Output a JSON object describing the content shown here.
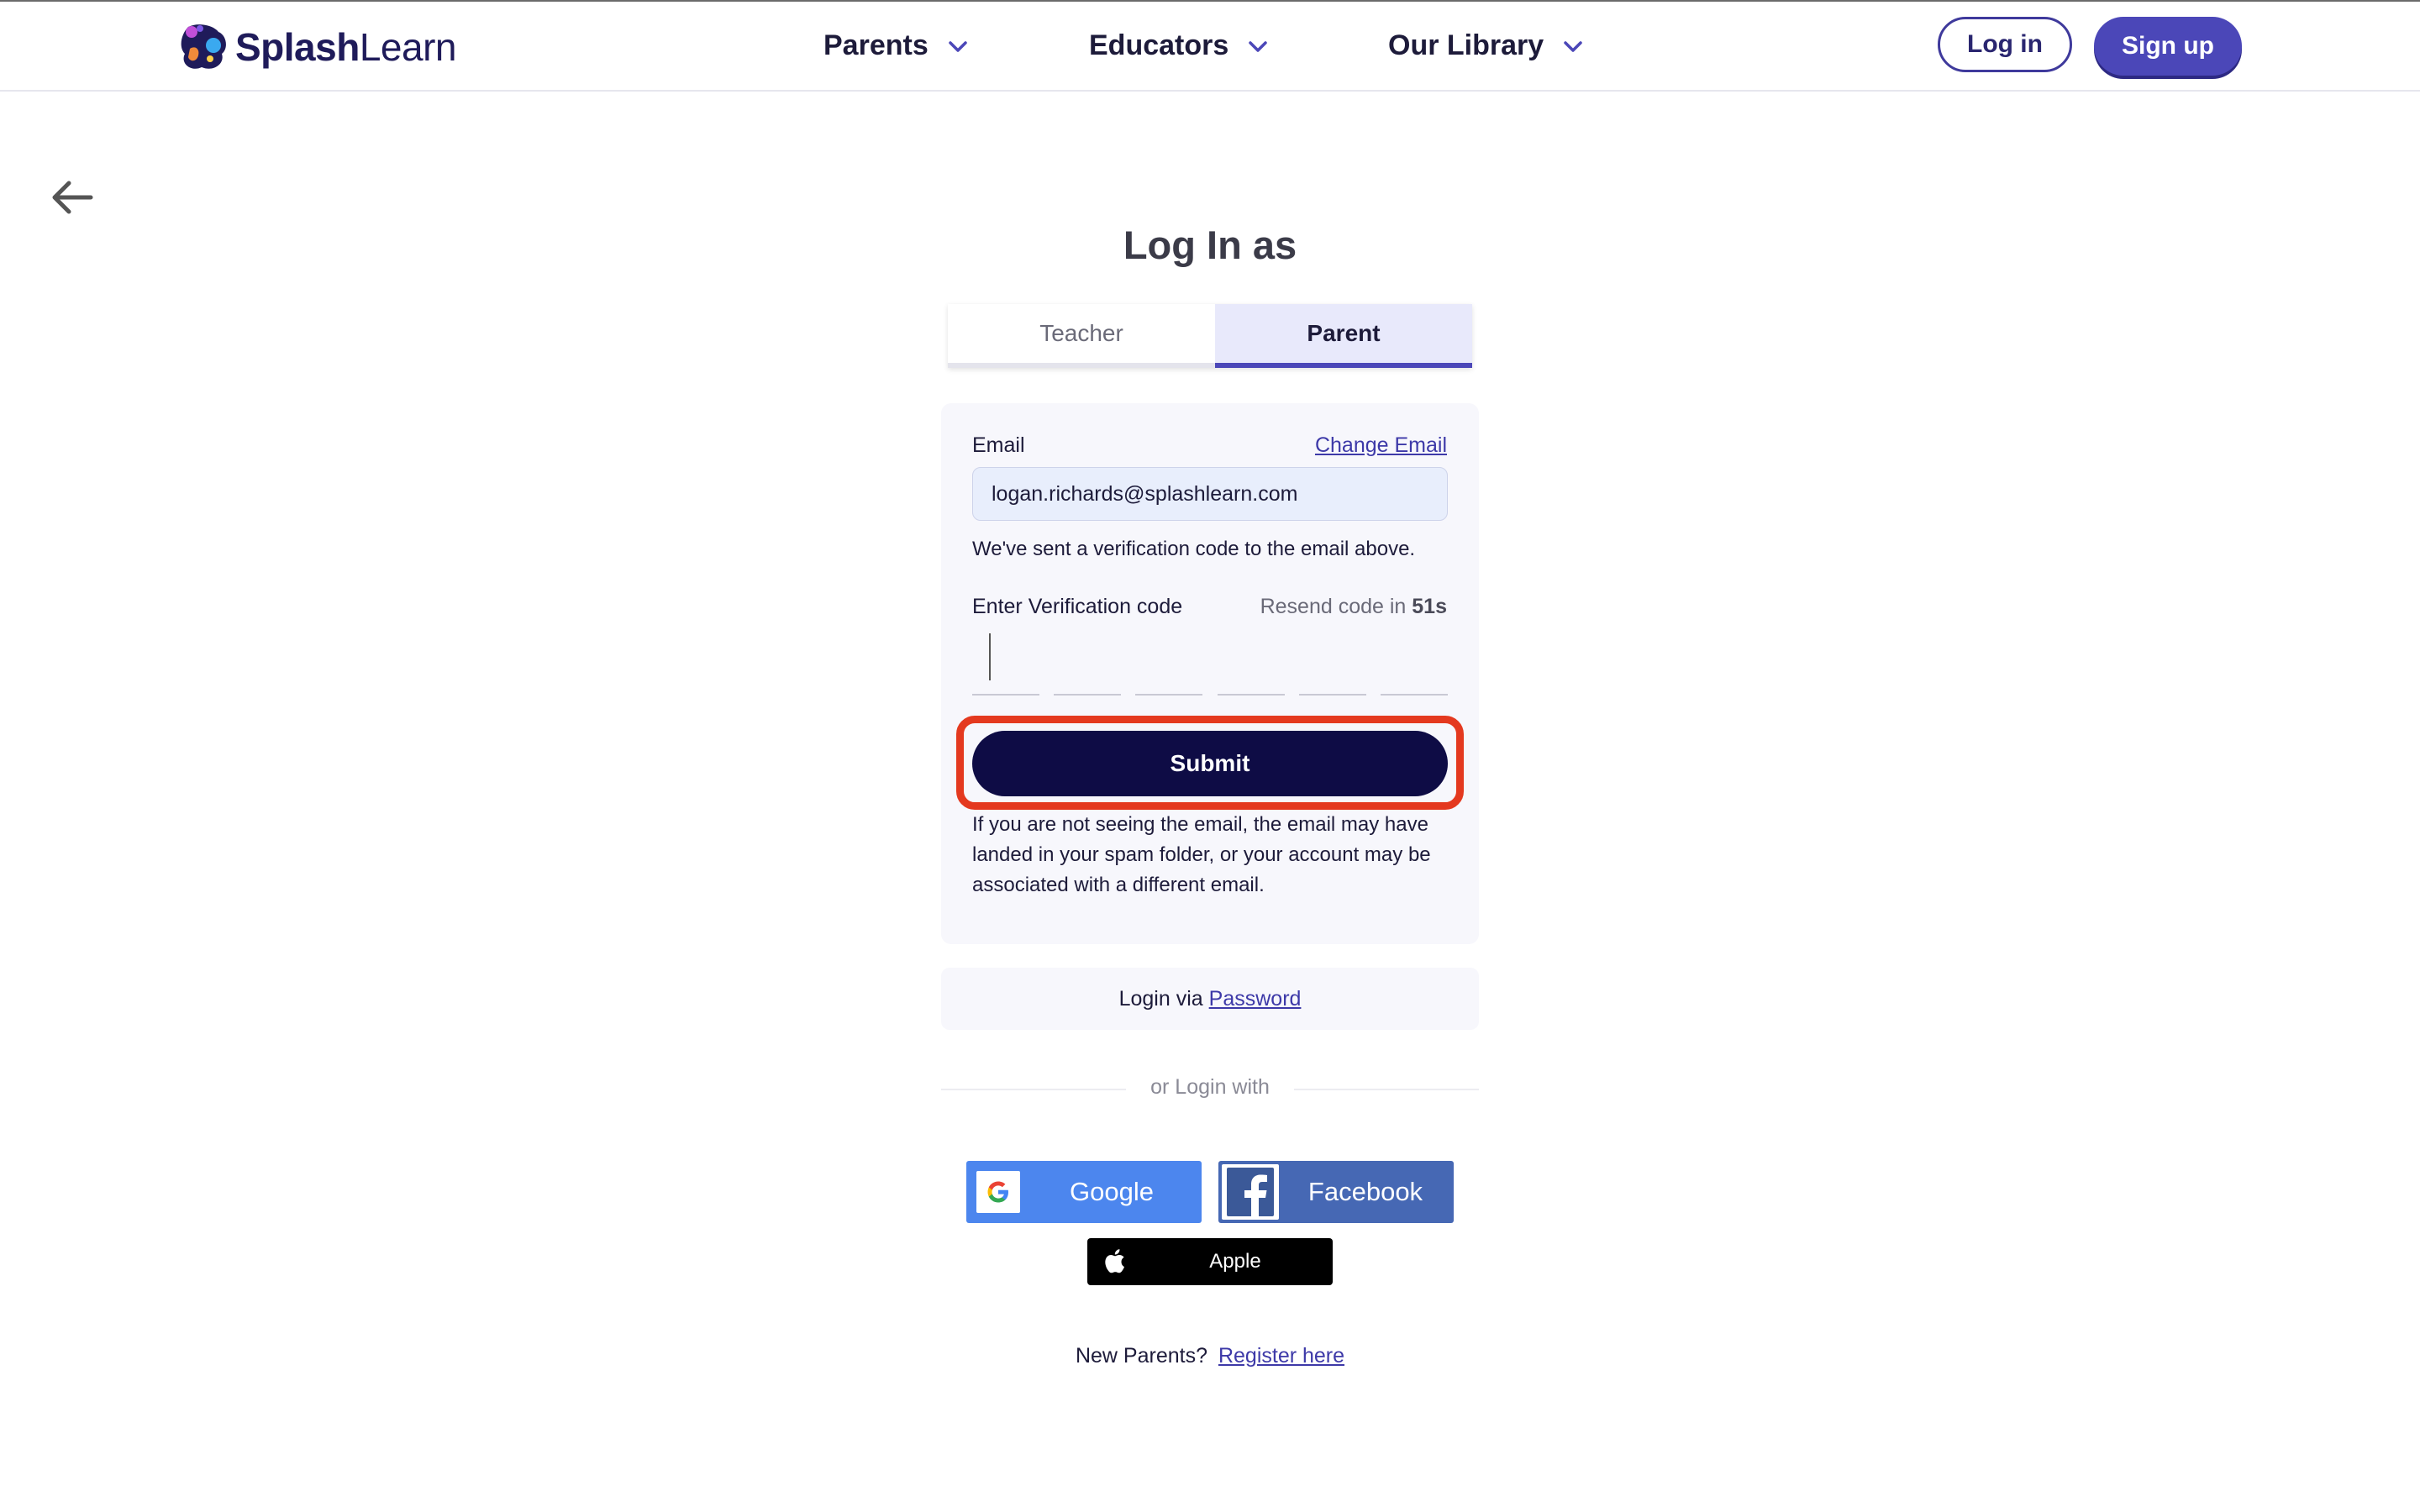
{
  "header": {
    "logo_text_bold": "Splash",
    "logo_text_light": "Learn",
    "nav": [
      {
        "label": "Parents"
      },
      {
        "label": "Educators"
      },
      {
        "label": "Our Library"
      }
    ],
    "login_label": "Log in",
    "signup_label": "Sign up",
    "accent_color": "#4b47b8"
  },
  "page": {
    "title": "Log In as",
    "tabs": [
      {
        "label": "Teacher",
        "selected": false
      },
      {
        "label": "Parent",
        "selected": true
      }
    ]
  },
  "form": {
    "email_label": "Email",
    "change_email_label": "Change Email",
    "email_value": "logan.richards@splashlearn.com",
    "sent_message": "We've sent a verification code to the email above.",
    "code_label": "Enter Verification code",
    "resend_prefix": "Resend code in",
    "resend_seconds": "51s",
    "otp_digits": [
      "",
      "",
      "",
      "",
      "",
      ""
    ],
    "submit_label": "Submit",
    "submit_color": "#0e0c45",
    "highlight_color": "#e4391f",
    "note": "If you are not seeing the email, the email may have landed in your spam folder, or your account may be associated with a different email."
  },
  "password_login": {
    "prefix": "Login via",
    "link": "Password"
  },
  "social": {
    "divider": "or Login with",
    "google_label": "Google",
    "facebook_label": "Facebook",
    "apple_label": "Apple",
    "google_color": "#4c86ee",
    "facebook_color": "#4668b4"
  },
  "register": {
    "prefix": "New Parents?",
    "link": "Register here"
  }
}
